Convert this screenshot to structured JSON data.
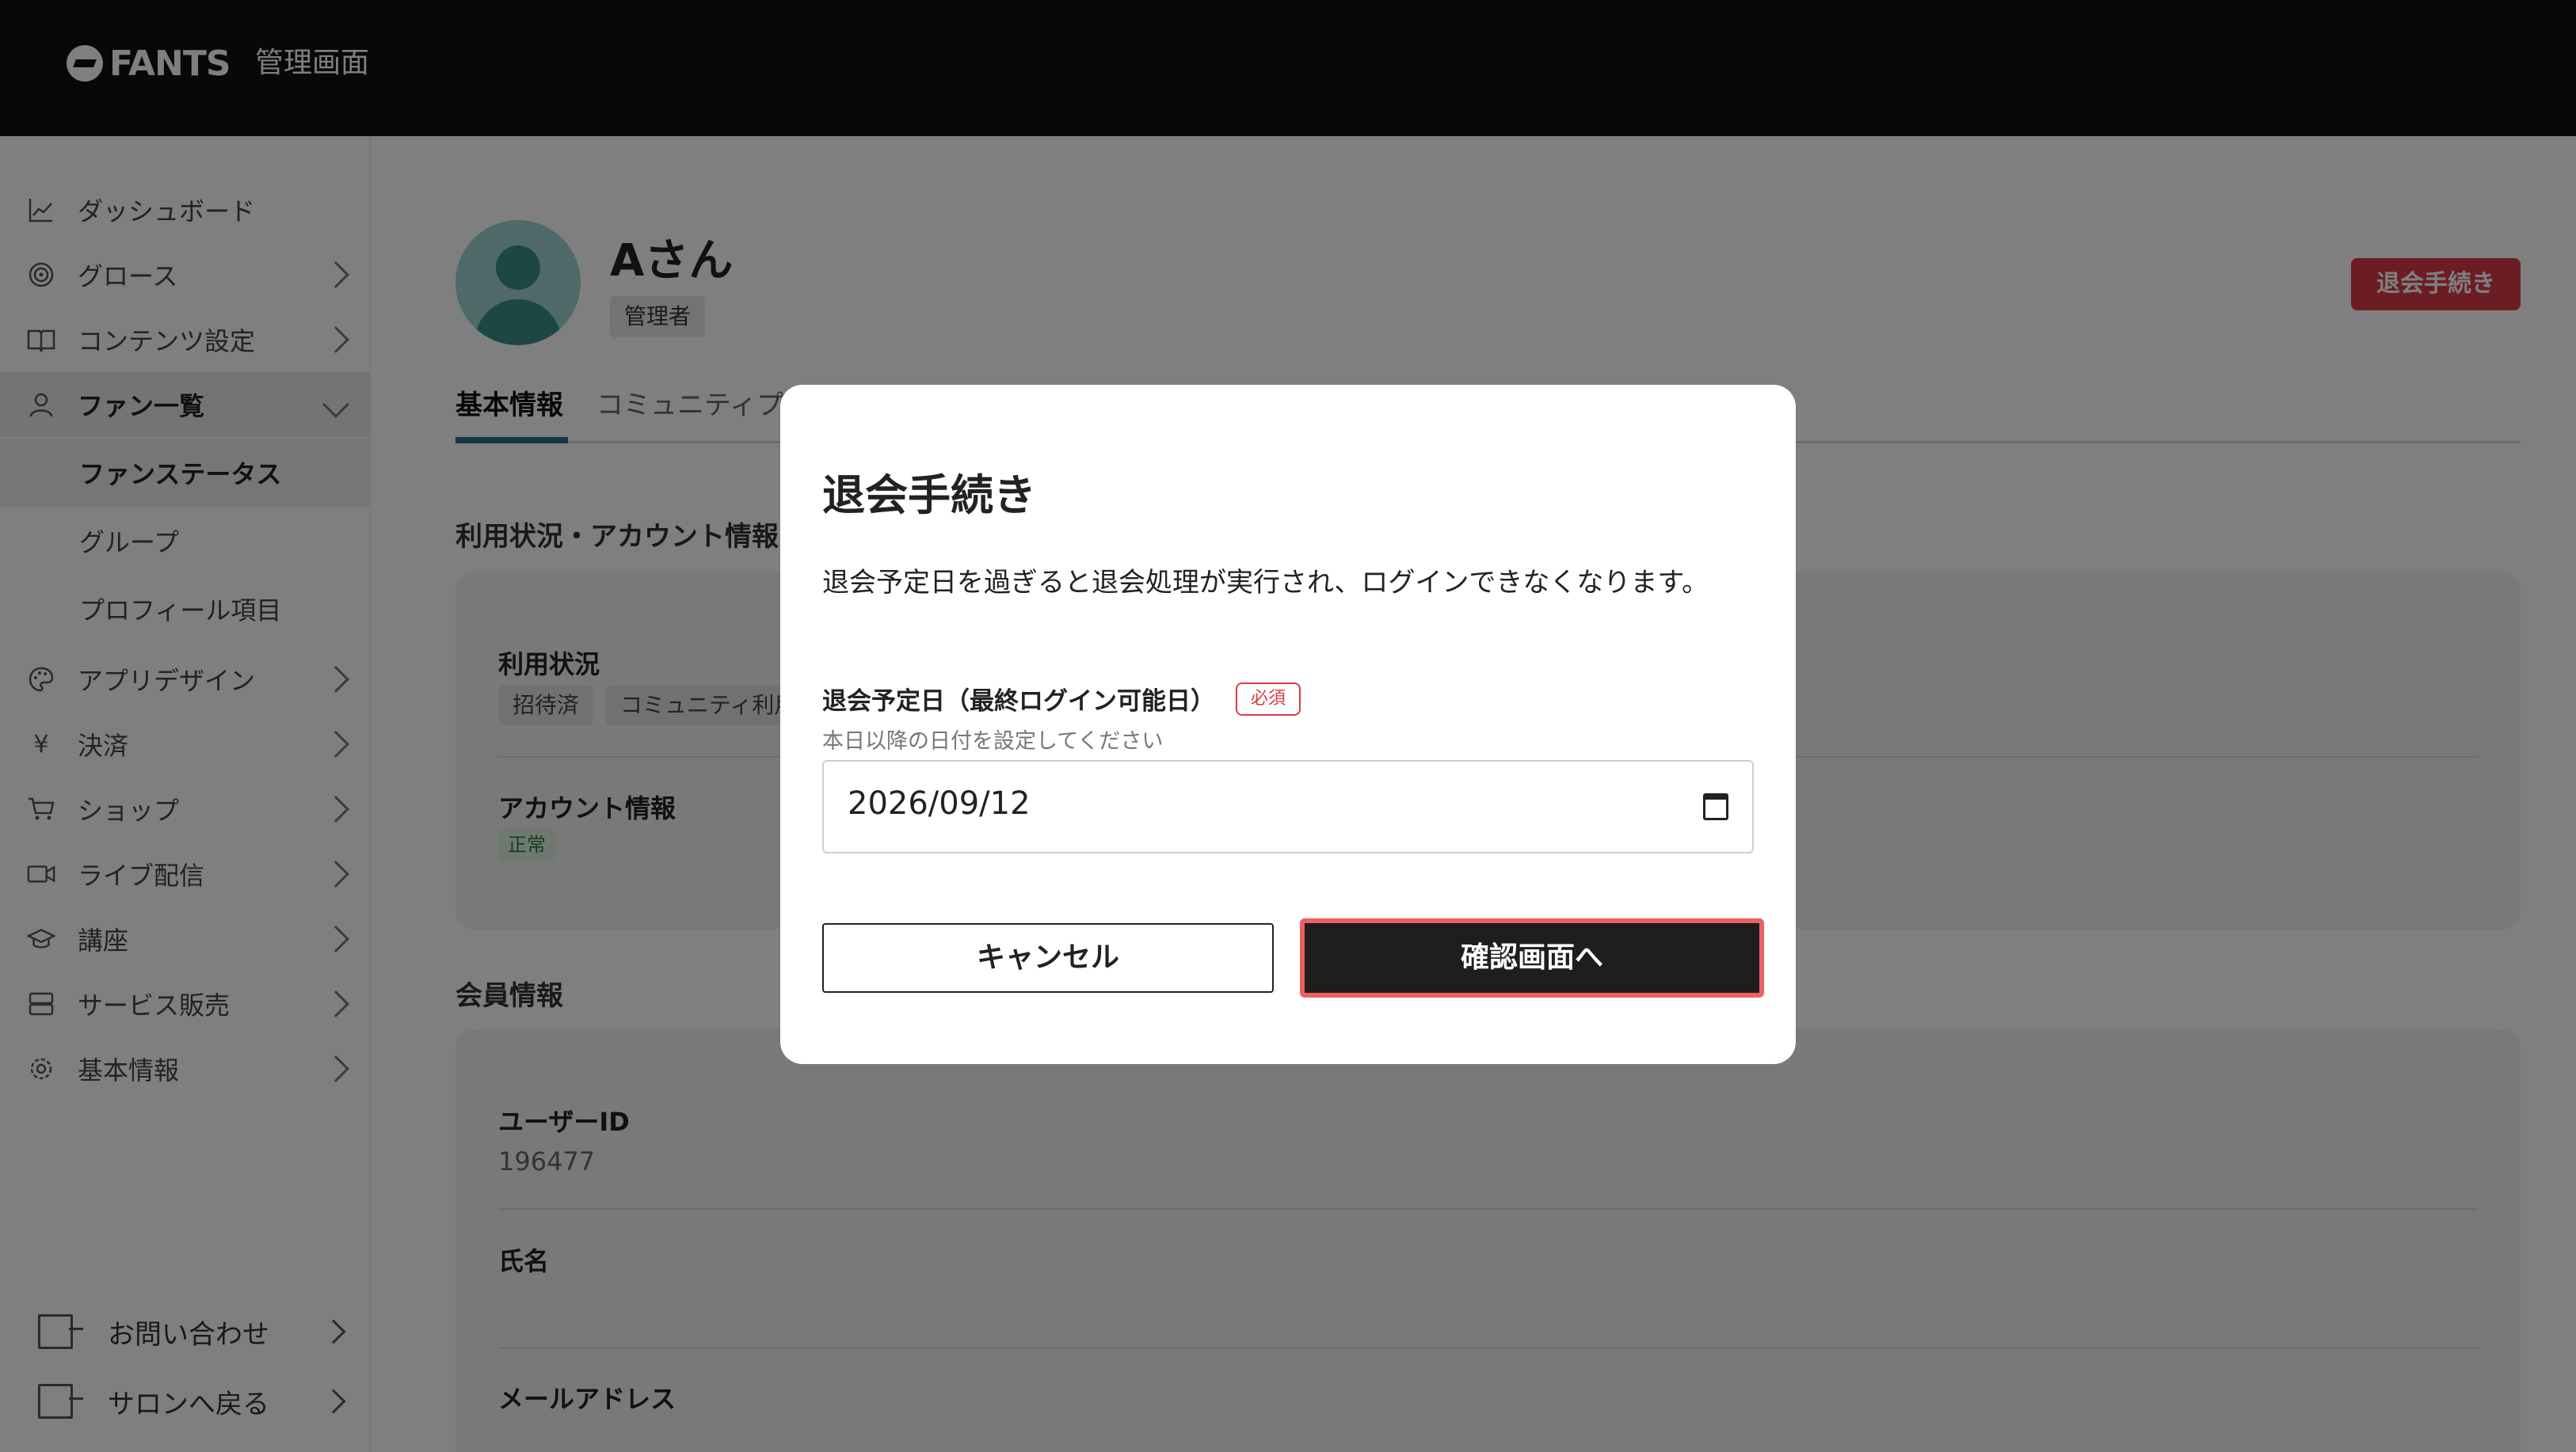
{
  "header": {
    "logo": "FANTS",
    "title": "管理画面"
  },
  "sidebar": {
    "items": [
      {
        "label": "ダッシュボード",
        "icon": "chart-line-icon"
      },
      {
        "label": "グロース",
        "icon": "target-icon"
      },
      {
        "label": "コンテンツ設定",
        "icon": "book-icon"
      },
      {
        "label": "ファン一覧",
        "icon": "user-icon"
      },
      {
        "label": "アプリデザイン",
        "icon": "palette-icon"
      },
      {
        "label": "決済",
        "icon": "yen-icon"
      },
      {
        "label": "ショップ",
        "icon": "cart-icon"
      },
      {
        "label": "ライブ配信",
        "icon": "video-icon"
      },
      {
        "label": "講座",
        "icon": "graduation-cap-icon"
      },
      {
        "label": "サービス販売",
        "icon": "storage-icon"
      },
      {
        "label": "基本情報",
        "icon": "gear-icon"
      }
    ],
    "sub_items": [
      "ファンステータス",
      "グループ",
      "プロフィール項目"
    ],
    "footer": [
      "お問い合わせ",
      "サロンへ戻る"
    ]
  },
  "profile": {
    "name": "Aさん",
    "role": "管理者",
    "withdraw_button": "退会手続き"
  },
  "tabs": [
    "基本情報",
    "コミュニティプ"
  ],
  "sections": {
    "usage_title": "利用状況・アカウント情報",
    "usage_label": "利用状況",
    "usage_chips": [
      "招待済",
      "コミュニティ利用"
    ],
    "account_label": "アカウント情報",
    "account_status": "正常",
    "member_title": "会員情報",
    "user_id_label": "ユーザーID",
    "user_id_value": "196477",
    "name_label": "氏名",
    "email_label": "メールアドレス"
  },
  "modal": {
    "title": "退会手続き",
    "description": "退会予定日を過ぎると退会処理が実行され、ログインできなくなります。",
    "date_label": "退会予定日（最終ログイン可能日）",
    "required": "必須",
    "date_hint": "本日以降の日付を設定してください",
    "date_value": "2026/09/12",
    "cancel": "キャンセル",
    "confirm": "確認画面へ"
  }
}
